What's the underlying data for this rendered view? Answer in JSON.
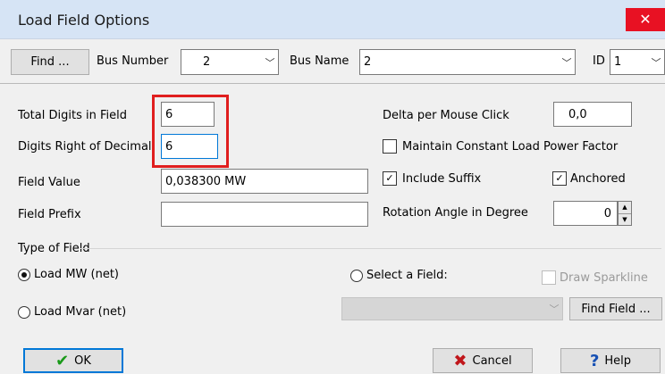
{
  "window": {
    "title": "Load Field Options",
    "close_glyph": "✕"
  },
  "topbar": {
    "find_button": "Find ...",
    "bus_number_label": "Bus Number",
    "bus_number_value": "2",
    "bus_name_label": "Bus Name",
    "bus_name_value": "2",
    "id_label": "ID",
    "id_value": "1"
  },
  "fields": {
    "total_digits_label": "Total Digits in Field",
    "total_digits_value": "6",
    "digits_right_label": "Digits Right of Decimal",
    "digits_right_value": "6",
    "field_value_label": "Field Value",
    "field_value_value": "0,038300 MW",
    "field_prefix_label": "Field Prefix",
    "field_prefix_value": ""
  },
  "options": {
    "delta_label": "Delta per Mouse Click",
    "delta_value": "0,0",
    "maintain_pf_label": "Maintain Constant Load Power Factor",
    "maintain_pf_checked": false,
    "include_suffix_label": "Include Suffix",
    "include_suffix_checked": true,
    "anchored_label": "Anchored",
    "anchored_checked": true,
    "rotation_label": "Rotation Angle in Degree",
    "rotation_value": "0"
  },
  "type_of_field": {
    "legend": "Type of Field",
    "load_mw_label": "Load MW (net)",
    "load_mvar_label": "Load Mvar (net)",
    "select_field_label": "Select a Field:",
    "draw_sparkline_label": "Draw Sparkline",
    "find_field_button": "Find Field ...",
    "selected": "load_mw"
  },
  "footer": {
    "ok_label": "OK",
    "cancel_label": "Cancel",
    "help_label": "Help"
  },
  "colors": {
    "highlight": "#e01e1e",
    "titlebar": "#d6e4f5",
    "close": "#e81123"
  }
}
